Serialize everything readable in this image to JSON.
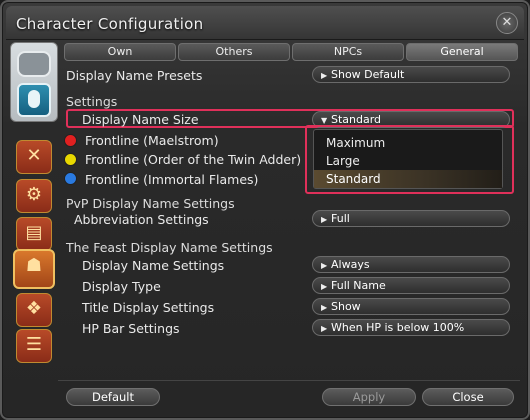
{
  "window": {
    "title": "Character Configuration"
  },
  "tabs": [
    "Own",
    "Others",
    "NPCs",
    "General"
  ],
  "active_tab": "General",
  "rows": {
    "display_name_presets": {
      "label": "Display Name Presets",
      "value": "Show Default"
    },
    "settings_heading": "Settings",
    "display_name_size": {
      "label": "Display Name Size",
      "value": "Standard"
    },
    "frontline_maelstrom": "Frontline (Maelstrom)",
    "frontline_twin_adder": "Frontline (Order of the Twin Adder)",
    "frontline_immortal": "Frontline (Immortal Flames)",
    "pvp_heading": "PvP Display Name Settings",
    "abbreviation": {
      "label": "Abbreviation Settings",
      "value": "Full"
    },
    "feast_heading": "The Feast Display Name Settings",
    "feast_display_name": {
      "label": "Display Name Settings",
      "value": "Always"
    },
    "display_type": {
      "label": "Display Type",
      "value": "Full Name"
    },
    "title_display": {
      "label": "Title Display Settings",
      "value": "Show"
    },
    "hp_bar": {
      "label": "HP Bar Settings",
      "value": "When HP is below 100%"
    }
  },
  "dropdown_options": [
    "Maximum",
    "Large",
    "Standard"
  ],
  "dropdown_selected": "Standard",
  "buttons": {
    "default": "Default",
    "apply": "Apply",
    "close": "Close"
  },
  "icons": {
    "close": "gear-close-icon",
    "gamepad": "gamepad-icon",
    "mouse": "mouse-icon"
  },
  "colors": {
    "highlight": "#e0305a",
    "maelstrom": "#e02020",
    "twin_adder": "#e8d800",
    "immortal": "#2a7ae0"
  }
}
